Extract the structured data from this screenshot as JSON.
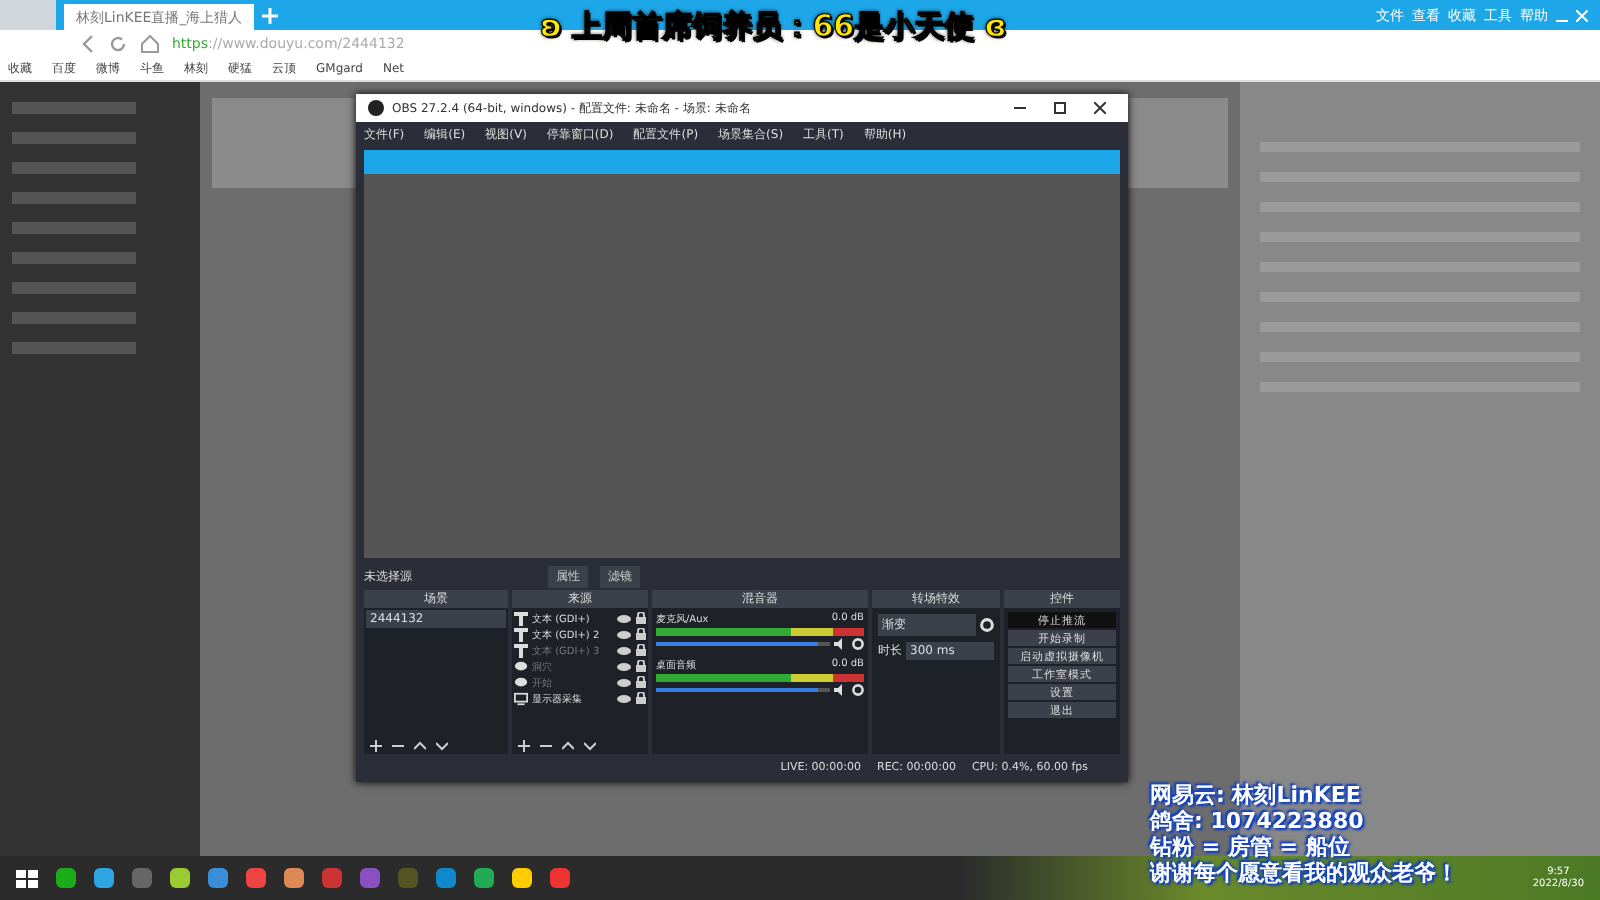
{
  "browser": {
    "tab_title": "林刻LinKEE直播_海上猎人",
    "menu": [
      "文件",
      "查看",
      "收藏",
      "工具",
      "帮助"
    ],
    "url_scheme": "https",
    "url_rest": "://www.douyu.com/2444132",
    "bookmarks": [
      "收藏",
      "百度",
      "微博",
      "斗鱼",
      "林刻",
      "硬猛",
      "云顶",
      "GMgard",
      "Net"
    ]
  },
  "obs": {
    "title": "OBS 27.2.4 (64-bit, windows) - 配置文件: 未命名 - 场景: 未命名",
    "menu": [
      "文件(F)",
      "编辑(E)",
      "视图(V)",
      "停靠窗口(D)",
      "配置文件(P)",
      "场景集合(S)",
      "工具(T)",
      "帮助(H)"
    ],
    "source_bar": {
      "label": "未选择源",
      "buttons": [
        "属性",
        "滤镜"
      ]
    },
    "docks": [
      "场景",
      "来源",
      "混音器",
      "转场特效",
      "控件"
    ],
    "scenes": [
      {
        "name": "2444132",
        "selected": true
      }
    ],
    "sources": [
      {
        "name": "文本 (GDI+)",
        "kind": "text",
        "active": true
      },
      {
        "name": "文本 (GDI+) 2",
        "kind": "text",
        "active": true
      },
      {
        "name": "文本 (GDI+) 3",
        "kind": "text",
        "active": false
      },
      {
        "name": "洞穴",
        "kind": "media",
        "active": false
      },
      {
        "name": "开始",
        "kind": "media",
        "active": false
      },
      {
        "name": "显示器采集",
        "kind": "display",
        "active": true
      }
    ],
    "mixer": [
      {
        "name": "麦克风/Aux",
        "reading": "0.0 dB",
        "level": 0.93
      },
      {
        "name": "桌面音频",
        "reading": "0.0 dB",
        "level": 0.93
      }
    ],
    "transition": {
      "value": "渐变",
      "duration_label": "时长",
      "duration": "300 ms"
    },
    "controls": [
      {
        "label": "停止推流",
        "active": true
      },
      {
        "label": "开始录制",
        "active": false
      },
      {
        "label": "启动虚拟摄像机",
        "active": false
      },
      {
        "label": "工作室模式",
        "active": false
      },
      {
        "label": "设置",
        "active": false
      },
      {
        "label": "退出",
        "active": false
      }
    ],
    "status": {
      "live": "LIVE: 00:00:00",
      "rec": "REC: 00:00:00",
      "cpu": "CPU: 0.4%, 60.00 fps"
    }
  },
  "overlay": {
    "top_banner": "ʚ 上周首席饲养员：66是小天使 ɞ",
    "lines": [
      "网易云: 林刻LinKEE",
      "鸽舍: 1074223880",
      "钻粉 = 房管 = 船位",
      "谢谢每个愿意看我的观众老爷！"
    ]
  },
  "taskbar": {
    "time": "9:57",
    "date": "2022/8/30"
  }
}
